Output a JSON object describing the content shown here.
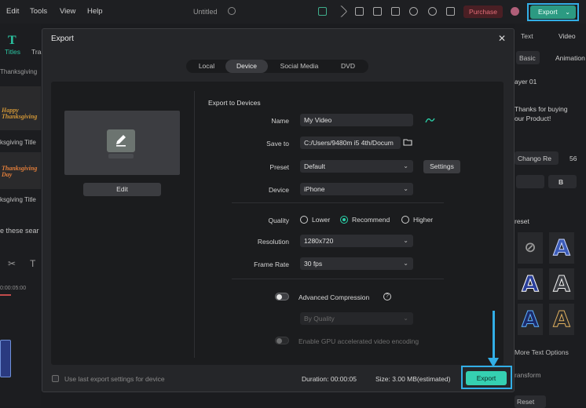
{
  "menu": {
    "edit": "Edit",
    "tools": "Tools",
    "view": "View",
    "help": "Help"
  },
  "doc": {
    "title": "Untitled"
  },
  "topbar": {
    "purchase": "Purchase",
    "export": "Export"
  },
  "left_panel": {
    "tab_titles": "Titles",
    "tab_other": "Tra",
    "thanksgiving_header": "Thanksgiving",
    "card1_text": "Happy\nThanksgiving",
    "card1_label": "ksgiving Title",
    "card2_text": "Thanksgiving\nDay",
    "card2_label": "ksgiving Title",
    "search_hint": "e these sear",
    "timecode": "0:00:05:00"
  },
  "right_panel": {
    "tab_text": "Text",
    "tab_video": "Video",
    "sub_basic": "Basic",
    "sub_animation": "Animation",
    "layer": "ayer 01",
    "body_text": "Thanks for buying\nour Product!",
    "font": "Chango Re",
    "font_size": "56",
    "bold": "B",
    "preset": "reset",
    "more_options": "More Text Options",
    "transform": "ransform",
    "reset": "Reset"
  },
  "dialog": {
    "title": "Export",
    "tabs": [
      "Local",
      "Device",
      "Social Media",
      "DVD"
    ],
    "active_tab": "Device",
    "edit_button": "Edit",
    "section_title": "Export to Devices",
    "name_label": "Name",
    "name_value": "My Video",
    "save_label": "Save to",
    "save_value": "C:/Users/9480m i5 4th/Docum",
    "preset_label": "Preset",
    "preset_value": "Default",
    "settings_button": "Settings",
    "device_label": "Device",
    "device_value": "iPhone",
    "quality_label": "Quality",
    "quality_options": [
      "Lower",
      "Recommend",
      "Higher"
    ],
    "quality_selected": "Recommend",
    "resolution_label": "Resolution",
    "resolution_value": "1280x720",
    "framerate_label": "Frame Rate",
    "framerate_value": "30 fps",
    "advanced_compression": "Advanced Compression",
    "by_quality": "By Quality",
    "gpu_label": "Enable GPU accelerated video encoding",
    "footer_checkbox": "Use last export settings for device",
    "duration": "Duration: 00:00:05",
    "size": "Size: 3.00 MB(estimated)",
    "export_button": "Export"
  },
  "colors": {
    "accent": "#35d0b1",
    "highlight": "#32aee6",
    "purchase": "#e46d78"
  }
}
